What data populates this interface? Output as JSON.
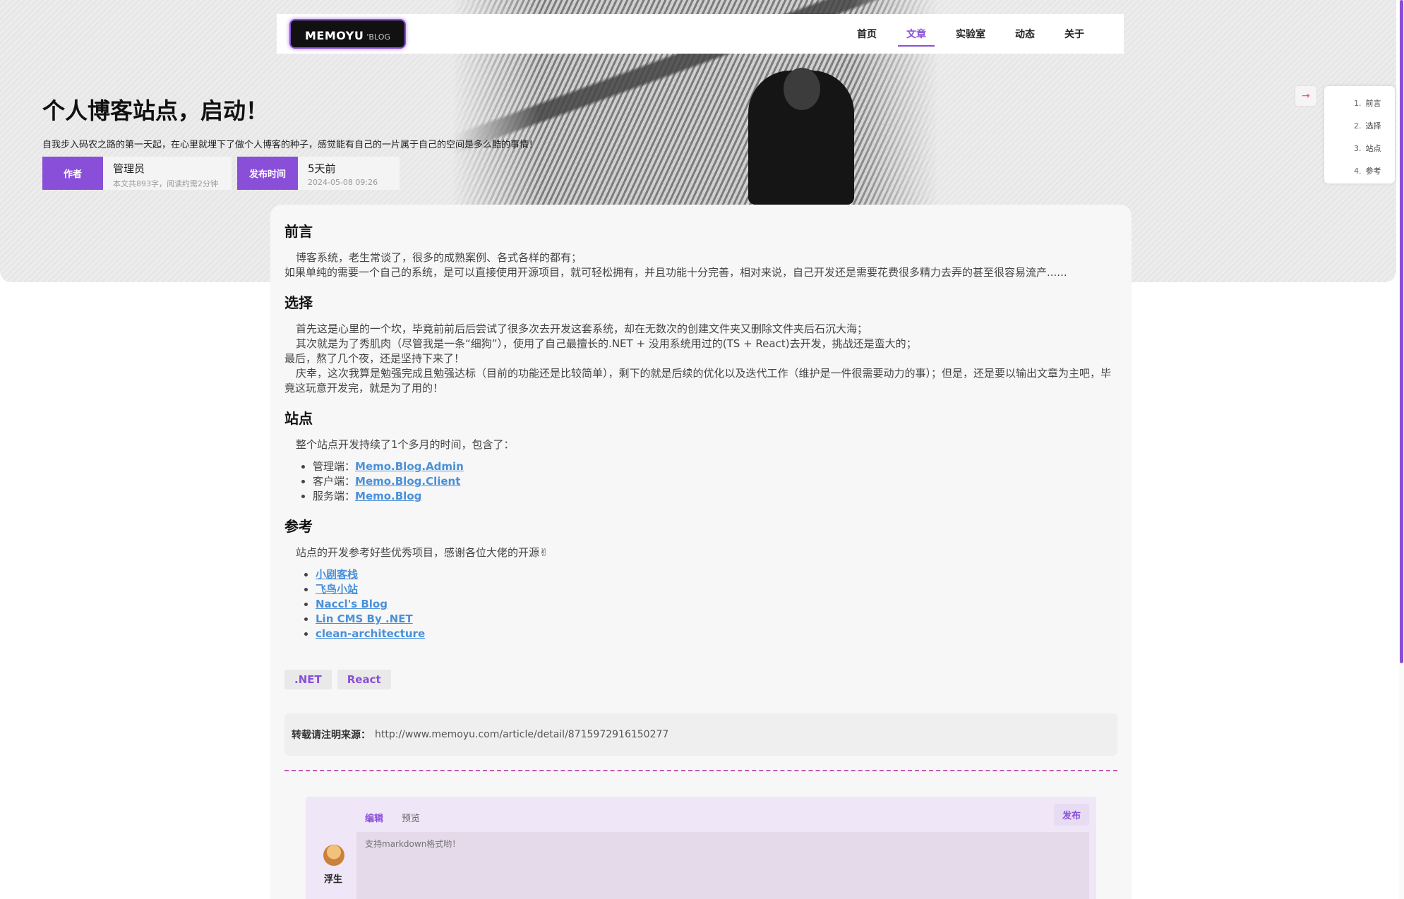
{
  "nav": {
    "logo_main": "MEMOYU",
    "logo_sub": "'BLOG",
    "items": [
      {
        "label": "首页"
      },
      {
        "label": "文章"
      },
      {
        "label": "实验室"
      },
      {
        "label": "动态"
      },
      {
        "label": "关于"
      }
    ],
    "active": "文章"
  },
  "hero": {
    "title": "个人博客站点，启动！",
    "description": "自我步入码农之路的第一天起，在心里就埋下了做个人博客的种子，感觉能有自己的一片属于自己的空间是多么酷的事情！",
    "author_label": "作者",
    "author_name": "管理员",
    "author_sub": "本文共893字，阅读约需2分钟",
    "time_label": "发布时间",
    "time_main": "5天前",
    "time_sub": "2024-05-08 09:26"
  },
  "article": {
    "sections": [
      {
        "heading": "前言",
        "lines": [
          "博客系统，老生常谈了，很多的成熟案例、各式各样的都有；",
          "如果单纯的需要一个自己的系统，是可以直接使用开源项目，就可轻松拥有，并且功能十分完善，相对来说，自己开发还是需要花费很多精力去弄的甚至很容易流产......"
        ]
      },
      {
        "heading": "选择",
        "lines": [
          "首先这是心里的一个坎，毕竟前前后后尝试了很多次去开发这套系统，却在无数次的创建文件夹又删除文件夹后石沉大海；",
          "其次就是为了秀肌肉（尽管我是一条“细狗”），使用了自己最擅长的.NET + 没用系统用过的(TS + React)去开发，挑战还是蛮大的；",
          "最后，熬了几个夜，还是坚持下来了！",
          "庆幸，这次我算是勉强完成且勉强达标（目前的功能还是比较简单），剩下的就是后续的优化以及迭代工作（维护是一件很需要动力的事）；但是，还是要以输出文章为主吧，毕竟这玩意开发完，就是为了用的！"
        ]
      },
      {
        "heading": "站点",
        "intro": "整个站点开发持续了1个多月的时间，包含了：",
        "items": [
          {
            "prefix": "管理端：",
            "link": "Memo.Blog.Admin"
          },
          {
            "prefix": "客户端：",
            "link": "Memo.Blog.Client"
          },
          {
            "prefix": "服务端：",
            "link": "Memo.Blog"
          }
        ]
      },
      {
        "heading": "参考",
        "intro": "站点的开发参考好些优秀项目，感谢各位大佬的开源✌",
        "items": [
          {
            "link": "小剧客栈"
          },
          {
            "link": "飞鸟小站"
          },
          {
            "link": "Naccl's Blog"
          },
          {
            "link": "Lin CMS By .NET"
          },
          {
            "link": "clean-architecture"
          }
        ]
      }
    ],
    "tags": [
      ".NET",
      "React"
    ],
    "source_label": "转载请注明来源：",
    "source_url": "http://www.memoyu.com/article/detail/8715972916150277"
  },
  "comment": {
    "tab_edit": "编辑",
    "tab_preview": "预览",
    "publish": "发布",
    "placeholder": "支持markdown格式哟！",
    "user_name": "浮生"
  },
  "toc": {
    "arrow": "→",
    "items": [
      {
        "num": "1.",
        "label": "前言"
      },
      {
        "num": "2.",
        "label": "选择"
      },
      {
        "num": "3.",
        "label": "站点"
      },
      {
        "num": "4.",
        "label": "参考"
      }
    ]
  },
  "colors": {
    "accent": "#8a4fd8",
    "link": "#4a90d9"
  }
}
